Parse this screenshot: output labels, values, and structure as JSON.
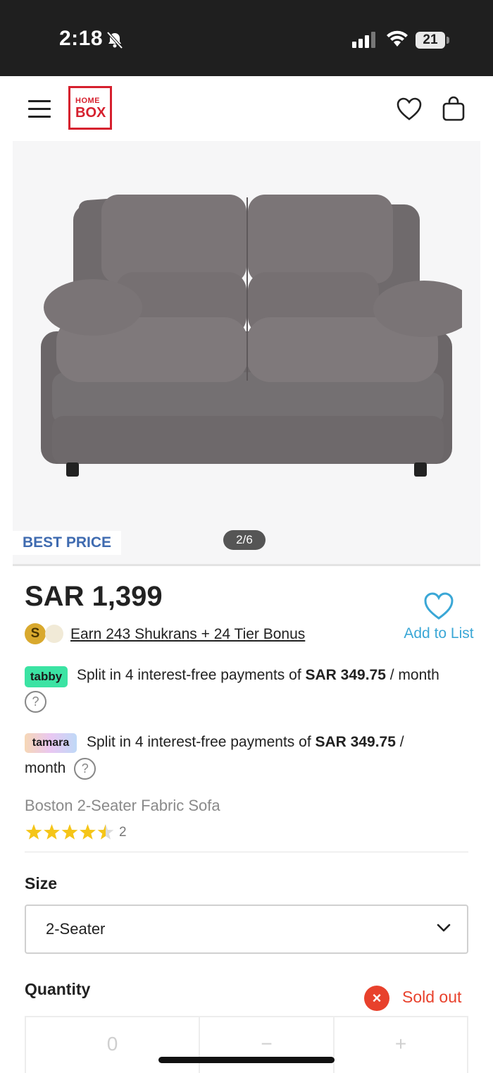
{
  "status_bar": {
    "time": "2:18",
    "battery": "21"
  },
  "header": {
    "logo_line1": "HOME",
    "logo_line2": "BOX"
  },
  "gallery": {
    "badge": "BEST PRICE",
    "counter": "2/6"
  },
  "product": {
    "price": "SAR 1,399",
    "shukran_coin": "S",
    "earn_text": "Earn 243 Shukrans + 24 Tier Bonus",
    "add_to_list": "Add to List",
    "tabby_logo": "tabby",
    "tabby_text_prefix": "Split in 4 interest-free payments of ",
    "tabby_amount": "SAR 349.75",
    "tabby_suffix": " / month",
    "tamara_logo": "tamara",
    "tamara_text_prefix": "Split in 4 interest-free payments of ",
    "tamara_amount": "SAR 349.75",
    "tamara_suffix": " /",
    "tamara_suffix2": "month",
    "help_glyph": "?",
    "name": "Boston 2-Seater Fabric Sofa",
    "rating": 4.5,
    "review_count": "2"
  },
  "size": {
    "label": "Size",
    "selected": "2-Seater"
  },
  "quantity": {
    "label": "Quantity",
    "sold_out": "Sold out",
    "sold_icon": "×",
    "value": "0",
    "minus": "−",
    "plus": "+"
  },
  "colors": {
    "brand_red": "#d6202e",
    "link_blue": "#3aa7d6",
    "badge_blue": "#3f6bb0",
    "sold_out_red": "#e8412c",
    "star_gold": "#f5c518"
  },
  "icons": [
    "bell-slash-icon",
    "signal-icon",
    "wifi-icon",
    "battery-icon",
    "menu-icon",
    "heart-icon",
    "bag-icon",
    "chevron-down-icon",
    "star-icon",
    "help-icon",
    "close-icon"
  ]
}
